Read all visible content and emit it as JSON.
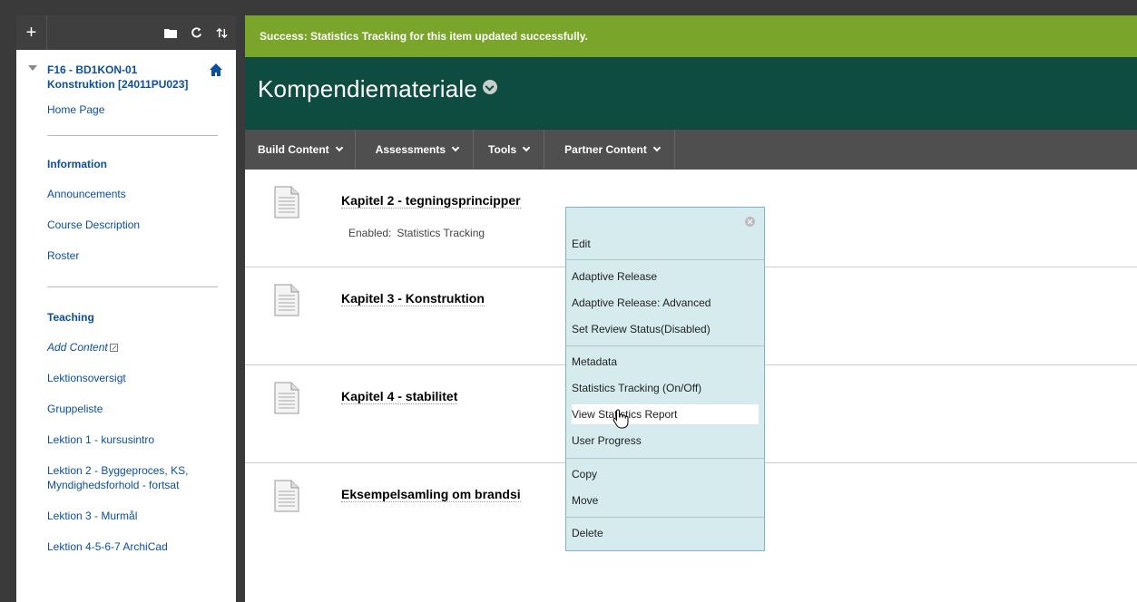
{
  "sidebar": {
    "toolbar": {
      "add": "+",
      "icons": [
        "folder-icon",
        "refresh-icon",
        "sort-icon"
      ]
    },
    "course_title": "F16 - BD1KON-01 Konstruktion [24011PU023]",
    "home_link": "Home Page",
    "sections": [
      {
        "heading": "Information",
        "links": [
          "Announcements",
          "Course Description",
          "Roster"
        ]
      },
      {
        "heading": "Teaching",
        "links": [
          "Add Content",
          "Lektionsoversigt",
          "Gruppeliste",
          "Lektion 1 - kursusintro",
          "Lektion 2 - Byggeproces, KS, Myndighedsforhold - fortsat",
          "Lektion 3 - Murmål",
          "Lektion 4-5-6-7 ArchiCad"
        ]
      }
    ]
  },
  "success_message": "Success: Statistics Tracking for this item updated successfully.",
  "page_title": "Kompendiemateriale",
  "action_bar": [
    "Build Content",
    "Assessments",
    "Tools",
    "Partner Content"
  ],
  "items": [
    {
      "title": "Kapitel 2 - tegningsprincipper",
      "meta_label": "Enabled:",
      "meta_value": "Statistics Tracking"
    },
    {
      "title": "Kapitel 3 - Konstruktion"
    },
    {
      "title": "Kapitel 4 - stabilitet"
    },
    {
      "title": "Eksempelsamling om brandsi"
    }
  ],
  "context_menu": {
    "groups": [
      [
        "Edit"
      ],
      [
        "Adaptive Release",
        "Adaptive Release: Advanced",
        "Set Review Status(Disabled)"
      ],
      [
        "Metadata",
        "Statistics Tracking (On/Off)",
        "View Statistics Report",
        "User Progress"
      ],
      [
        "Copy",
        "Move"
      ],
      [
        "Delete"
      ]
    ],
    "hovered": "View Statistics Report"
  },
  "colors": {
    "success": "#78a52a",
    "header": "#0e4c42",
    "menu_bg": "#d5ebee",
    "link": "#0b4fa3"
  }
}
